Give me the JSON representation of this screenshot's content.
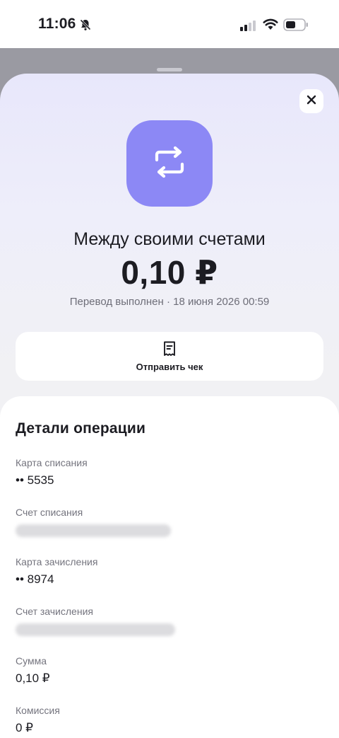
{
  "status_bar": {
    "time": "11:06",
    "icons": [
      "bell-off-icon",
      "cellular-signal-icon",
      "wifi-icon",
      "battery-icon"
    ]
  },
  "sheet": {
    "close_icon": "close-icon",
    "hero_icon": "transfer-arrows-icon",
    "hero_color": "#8c88f5",
    "title": "Между своими счетами",
    "amount": "0,10 ₽",
    "status": "Перевод выполнен · 18 июня 2026 00:59",
    "receipt_button": {
      "icon": "receipt-icon",
      "label": "Отправить чек"
    }
  },
  "details": {
    "title": "Детали операции",
    "fields": [
      {
        "label": "Карта списания",
        "value": "•• 5535"
      },
      {
        "label": "Счет списания",
        "value": ""
      },
      {
        "label": "Карта зачисления",
        "value": "•• 8974"
      },
      {
        "label": "Счет зачисления",
        "value": ""
      },
      {
        "label": "Сумма",
        "value": "0,10 ₽"
      },
      {
        "label": "Комиссия",
        "value": "0 ₽"
      }
    ]
  }
}
